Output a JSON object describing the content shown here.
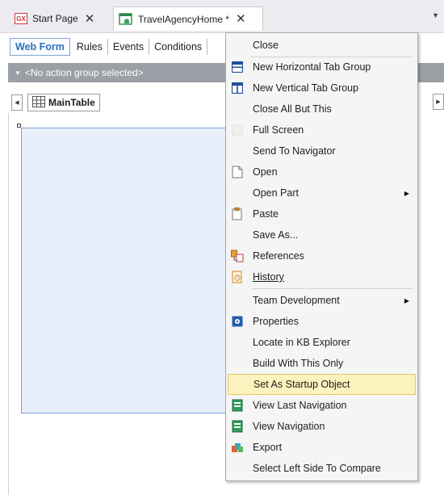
{
  "tabs": [
    {
      "label": "Start Page",
      "icon": "gx-logo-icon",
      "active": false
    },
    {
      "label": "TravelAgencyHome *",
      "icon": "webform-object-icon",
      "active": true
    }
  ],
  "gx_logo_text": "GX",
  "close_glyph": "✕",
  "subtabs": [
    "Web Form",
    "Rules",
    "Events",
    "Conditions"
  ],
  "action_group": "<No action group selected>",
  "breadcrumb": "MainTable",
  "menu": {
    "items": [
      {
        "label": "Close",
        "icon": null,
        "submenu": false
      },
      {
        "label": "New Horizontal Tab Group",
        "icon": "horizontal-tab-group-icon",
        "submenu": false
      },
      {
        "label": "New Vertical Tab Group",
        "icon": "vertical-tab-group-icon",
        "submenu": false
      },
      {
        "label": "Close All But This",
        "icon": null,
        "submenu": false
      },
      {
        "label": "Full Screen",
        "icon": "full-screen-icon",
        "submenu": false
      },
      {
        "label": "Send To Navigator",
        "icon": null,
        "submenu": false
      },
      {
        "label": "Open",
        "icon": "open-icon",
        "submenu": false
      },
      {
        "label": "Open Part",
        "icon": null,
        "submenu": true
      },
      {
        "label": "Paste",
        "icon": "paste-icon",
        "submenu": false
      },
      {
        "label": "Save As...",
        "icon": null,
        "submenu": false
      },
      {
        "label": "References",
        "icon": "references-icon",
        "submenu": false
      },
      {
        "label": "History",
        "icon": "history-icon",
        "submenu": false
      },
      {
        "label": "Team Development",
        "icon": null,
        "submenu": true
      },
      {
        "label": "Properties",
        "icon": "properties-icon",
        "submenu": false
      },
      {
        "label": "Locate in KB Explorer",
        "icon": null,
        "submenu": false
      },
      {
        "label": "Build With This Only",
        "icon": null,
        "submenu": false
      },
      {
        "label": "Set As Startup Object",
        "icon": null,
        "submenu": false,
        "highlighted": true
      },
      {
        "label": "View Last Navigation",
        "icon": "view-last-navigation-icon",
        "submenu": false
      },
      {
        "label": "View Navigation",
        "icon": "view-navigation-icon",
        "submenu": false
      },
      {
        "label": "Export",
        "icon": "export-icon",
        "submenu": false
      },
      {
        "label": "Select Left Side To Compare",
        "icon": null,
        "submenu": false
      }
    ]
  },
  "colors": {
    "accent": "#2f6fb8",
    "highlight_bg": "#fbf2bd",
    "highlight_border": "#e7c76a",
    "action_bar": "#9aa0a6",
    "canvas": "#e8eefa"
  }
}
